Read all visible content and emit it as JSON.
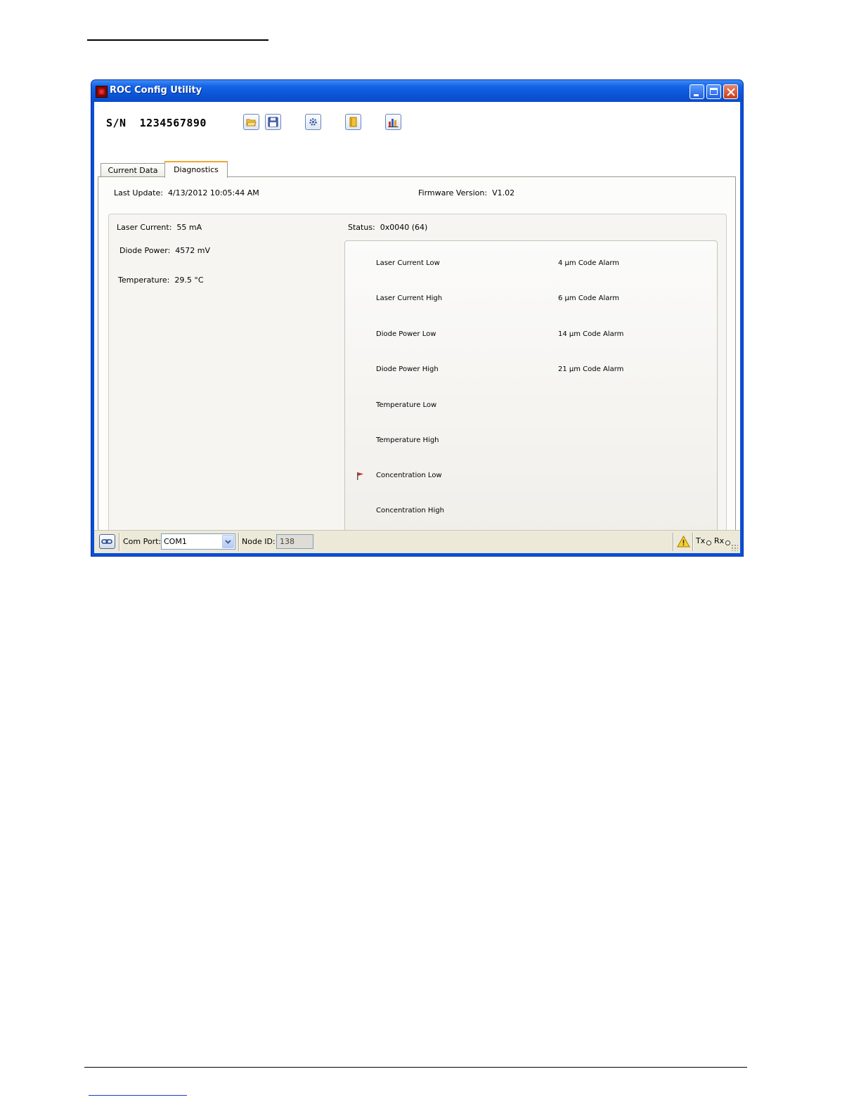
{
  "window": {
    "title": "ROC Config Utility"
  },
  "header": {
    "serial_label": "S/N",
    "serial_number": "1234567890"
  },
  "toolbar": {
    "icons": [
      "open-folder-icon",
      "save-disk-icon",
      "settings-gear-icon",
      "book-icon",
      "bar-chart-icon"
    ]
  },
  "tabs": [
    {
      "label": "Current Data",
      "selected": false
    },
    {
      "label": "Diagnostics",
      "selected": true
    }
  ],
  "diagnostics": {
    "last_update_label": "Last Update:",
    "last_update_value": "4/13/2012 10:05:44 AM",
    "firmware_label": "Firmware Version:",
    "firmware_value": "V1.02",
    "laser_current_label": "Laser Current:",
    "laser_current_value": "55 mA",
    "diode_power_label": "Diode Power:",
    "diode_power_value": "4572 mV",
    "temperature_label": "Temperature:",
    "temperature_value": "29.5 °C",
    "status_label": "Status:",
    "status_value": "0x0040 (64)",
    "flags_left": [
      {
        "label": "Laser Current Low",
        "active": false
      },
      {
        "label": "Laser Current High",
        "active": false
      },
      {
        "label": "Diode Power Low",
        "active": false
      },
      {
        "label": "Diode Power High",
        "active": false
      },
      {
        "label": "Temperature Low",
        "active": false
      },
      {
        "label": "Temperature High",
        "active": false
      },
      {
        "label": "Concentration Low",
        "active": true
      },
      {
        "label": "Concentration High",
        "active": false
      }
    ],
    "flags_right": [
      {
        "label": "4 µm Code Alarm",
        "active": false
      },
      {
        "label": "6 µm Code Alarm",
        "active": false
      },
      {
        "label": "14 µm Code Alarm",
        "active": false
      },
      {
        "label": "21 µm Code Alarm",
        "active": false
      }
    ]
  },
  "statusbar": {
    "com_port_label": "Com Port:",
    "com_port_value": "COM1",
    "node_id_label": "Node ID:",
    "node_id_value": "138",
    "tx_label": "Tx",
    "rx_label": "Rx"
  },
  "colors": {
    "title_bar": "#0a55d6",
    "active_flag": "#c0302a",
    "tab_accent": "#f0a830"
  }
}
